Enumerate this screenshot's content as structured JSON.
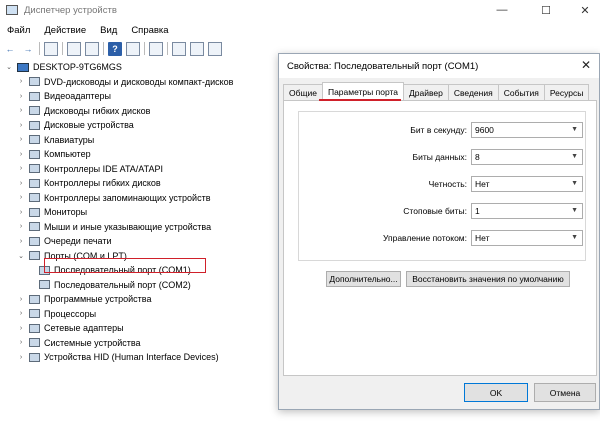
{
  "window": {
    "title": "Диспетчер устройств",
    "minimize": "—",
    "maximize": "☐",
    "close": "✕"
  },
  "menu": [
    "Файл",
    "Действие",
    "Вид",
    "Справка"
  ],
  "toolbar": {
    "back": "←",
    "forward": "→",
    "help": "?"
  },
  "tree": {
    "root": "DESKTOP-9TG6MGS",
    "items": [
      {
        "label": "DVD-дисководы и дисководы компакт-дисков",
        "expander": "›"
      },
      {
        "label": "Видеоадаптеры",
        "expander": "›"
      },
      {
        "label": "Дисководы гибких дисков",
        "expander": "›"
      },
      {
        "label": "Дисковые устройства",
        "expander": "›"
      },
      {
        "label": "Клавиатуры",
        "expander": "›"
      },
      {
        "label": "Компьютер",
        "expander": "›"
      },
      {
        "label": "Контроллеры IDE ATA/ATAPI",
        "expander": "›"
      },
      {
        "label": "Контроллеры гибких дисков",
        "expander": "›"
      },
      {
        "label": "Контроллеры запоминающих устройств",
        "expander": "›"
      },
      {
        "label": "Мониторы",
        "expander": "›"
      },
      {
        "label": "Мыши и иные указывающие устройства",
        "expander": "›"
      },
      {
        "label": "Очереди печати",
        "expander": "›"
      },
      {
        "label": "Порты (COM и LPT)",
        "expander": "⌄"
      }
    ],
    "ports": [
      "Последовательный порт (COM1)",
      "Последовательный порт (COM2)"
    ],
    "items_after": [
      {
        "label": "Программные устройства",
        "expander": "›"
      },
      {
        "label": "Процессоры",
        "expander": "›"
      },
      {
        "label": "Сетевые адаптеры",
        "expander": "›"
      },
      {
        "label": "Системные устройства",
        "expander": "›"
      },
      {
        "label": "Устройства HID (Human Interface Devices)",
        "expander": "›"
      }
    ]
  },
  "dialog": {
    "title": "Свойства: Последовательный порт (COM1)",
    "close": "✕",
    "tabs": [
      "Общие",
      "Параметры порта",
      "Драйвер",
      "Сведения",
      "События",
      "Ресурсы"
    ],
    "active_tab": "Параметры порта",
    "fields": [
      {
        "label": "Бит в секунду:",
        "value": "9600"
      },
      {
        "label": "Биты данных:",
        "value": "8"
      },
      {
        "label": "Четность:",
        "value": "Нет"
      },
      {
        "label": "Стоповые биты:",
        "value": "1"
      },
      {
        "label": "Управление потоком:",
        "value": "Нет"
      }
    ],
    "advanced_button": "Дополнительно...",
    "restore_button": "Восстановить значения по умолчанию",
    "ok_button": "OK",
    "cancel_button": "Отмена"
  },
  "colors": {
    "highlight": "#d0202a",
    "accent": "#0078d7"
  }
}
